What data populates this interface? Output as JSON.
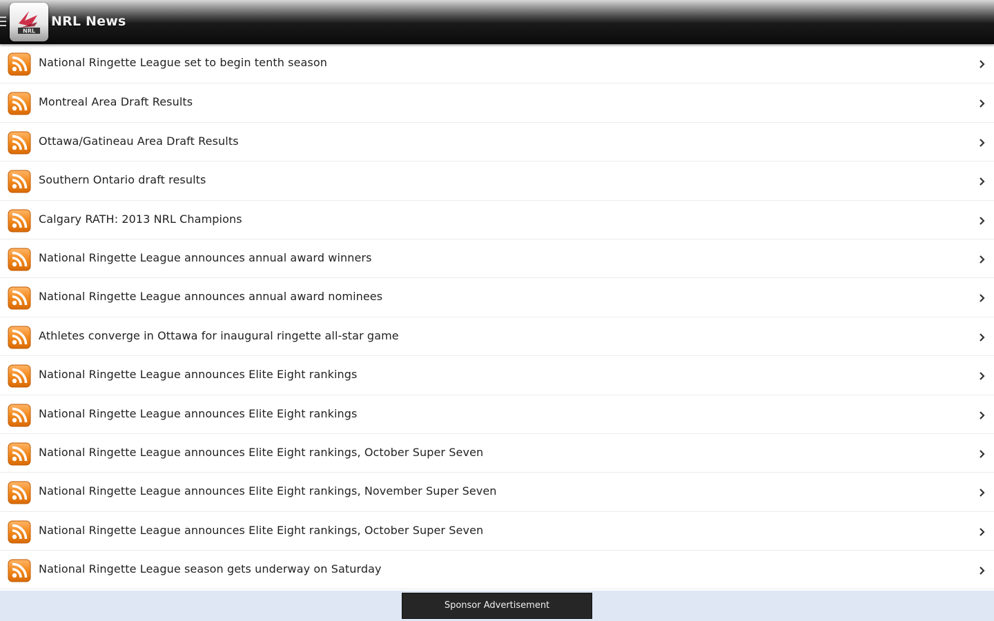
{
  "app_bar": {
    "title": "NRL News",
    "logo_text": "NRL"
  },
  "colors": {
    "rss_orange": "#f28a1e",
    "header_black": "#0a0a0a",
    "ad_background": "#dfe7f5",
    "sponsor_button": "#262626"
  },
  "news_items": [
    {
      "title": "National Ringette League set to begin tenth season",
      "icon": "rss-feed-icon"
    },
    {
      "title": "Montreal Area Draft Results",
      "icon": "rss-feed-icon"
    },
    {
      "title": "Ottawa/Gatineau Area Draft Results",
      "icon": "rss-feed-icon"
    },
    {
      "title": "Southern Ontario draft results",
      "icon": "rss-feed-icon"
    },
    {
      "title": "Calgary RATH: 2013 NRL Champions",
      "icon": "rss-feed-icon"
    },
    {
      "title": "National Ringette League announces annual award winners",
      "icon": "rss-feed-icon"
    },
    {
      "title": "National Ringette League announces annual award nominees",
      "icon": "rss-feed-icon"
    },
    {
      "title": "Athletes converge in Ottawa for inaugural ringette all-star game",
      "icon": "rss-feed-icon"
    },
    {
      "title": "National Ringette League announces Elite Eight rankings",
      "icon": "rss-feed-icon"
    },
    {
      "title": "National Ringette League announces Elite Eight rankings",
      "icon": "rss-feed-icon"
    },
    {
      "title": "National Ringette League announces Elite Eight rankings, October Super Seven",
      "icon": "rss-feed-icon"
    },
    {
      "title": "National Ringette League announces Elite Eight rankings, November Super Seven",
      "icon": "rss-feed-icon"
    },
    {
      "title": "National Ringette League announces Elite Eight rankings, October Super Seven",
      "icon": "rss-feed-icon"
    },
    {
      "title": "National Ringette League season gets underway on Saturday",
      "icon": "rss-feed-icon"
    }
  ],
  "ad": {
    "sponsor_label": "Sponsor Advertisement"
  }
}
